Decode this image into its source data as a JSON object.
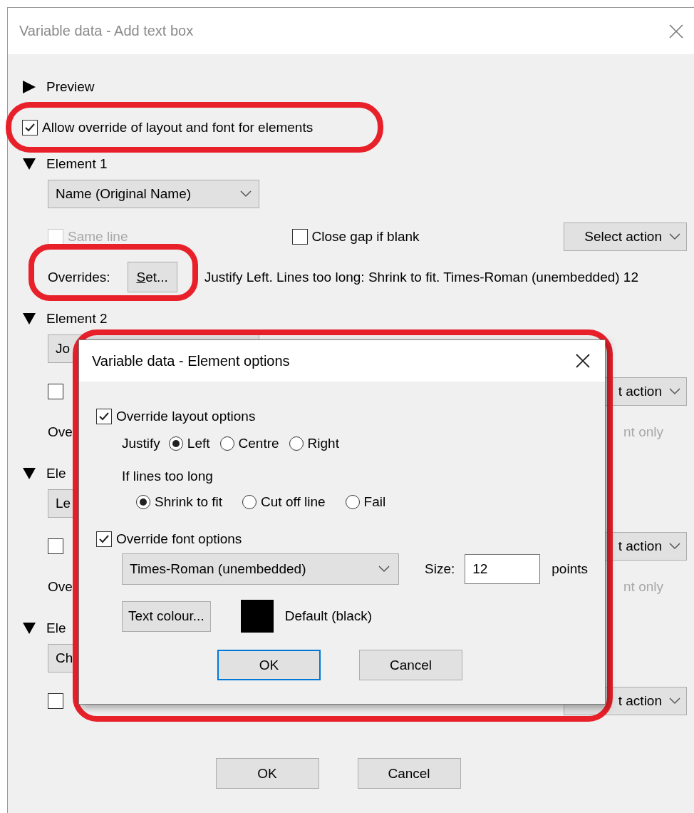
{
  "window": {
    "title": "Variable data - Add text box",
    "active": false
  },
  "preview": {
    "label": "Preview",
    "expanded": false
  },
  "allow_override": {
    "label": "Allow override of layout and font for elements",
    "checked": true
  },
  "elements": [
    {
      "title": "Element 1",
      "expanded": true,
      "field": "Name (Original Name)",
      "same_line": {
        "label": "Same line",
        "checked": false,
        "disabled": true
      },
      "close_gap": {
        "label": "Close gap if blank",
        "checked": false
      },
      "action": "Select action",
      "overrides_label": "Overrides:",
      "set_button": "Set...",
      "overrides_text": "Justify Left. Lines too long: Shrink to fit. Times-Roman (unembedded) 12",
      "overrides_text_disabled": false
    },
    {
      "title": "Element 2",
      "expanded": true,
      "field": "Jo",
      "same_line": {
        "checked": false,
        "disabled": false
      },
      "action": "t action",
      "overrides_label": "Ove",
      "overrides_text": "nt only",
      "overrides_text_disabled": true
    },
    {
      "title": "Ele",
      "expanded": true,
      "field": "Le",
      "same_line": {
        "checked": false,
        "disabled": false
      },
      "action": "t action",
      "overrides_label": "Ove",
      "overrides_text": "nt only",
      "overrides_text_disabled": true
    },
    {
      "title": "Ele",
      "expanded": true,
      "field": "Ch",
      "same_line": {
        "checked": false,
        "disabled": false
      },
      "action": "t action"
    }
  ],
  "buttons": [
    {
      "label": "OK"
    },
    {
      "label": "Cancel"
    }
  ],
  "modal": {
    "title": "Variable data - Element options",
    "active": true,
    "layout": {
      "label": "Override layout options",
      "checked": true
    },
    "justify": {
      "label": "Justify",
      "options": [
        {
          "label": "Left",
          "selected": true
        },
        {
          "label": "Centre",
          "selected": false
        },
        {
          "label": "Right",
          "selected": false
        }
      ]
    },
    "lines_too_long": {
      "label": "If lines too long",
      "options": [
        {
          "label": "Shrink to fit",
          "selected": true
        },
        {
          "label": "Cut off line",
          "selected": false
        },
        {
          "label": "Fail",
          "selected": false
        }
      ]
    },
    "font": {
      "label": "Override font options",
      "checked": true
    },
    "font_select": "Times-Roman (unembedded)",
    "size_label": "Size:",
    "size": "12",
    "size_unit": "points",
    "colour_button": "Text colour...",
    "colour_label": "Default (black)",
    "buttons": [
      {
        "label": "OK",
        "focused": true
      },
      {
        "label": "Cancel",
        "focused": false
      }
    ]
  }
}
